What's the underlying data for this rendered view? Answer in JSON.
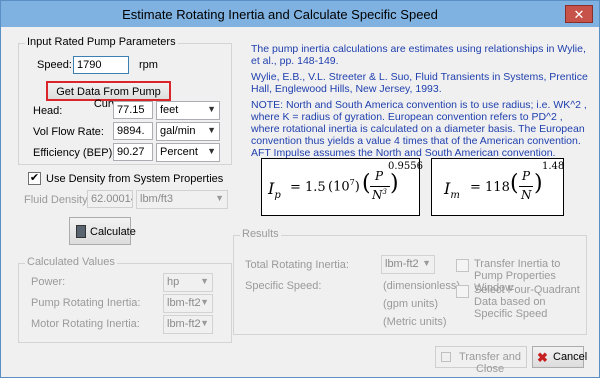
{
  "window": {
    "title": "Estimate Rotating Inertia and Calculate Specific Speed",
    "close_glyph": "✕"
  },
  "input_group": {
    "title": "Input Rated Pump Parameters",
    "speed_label": "Speed:",
    "speed_value": "1790",
    "speed_unit": "rpm",
    "get_data_button": "Get Data From Pump Curve",
    "head_label": "Head:",
    "head_value": "77.15",
    "head_unit": "feet",
    "flow_label": "Vol Flow Rate:",
    "flow_value": "9894.",
    "flow_unit": "gal/min",
    "eff_label": "Efficiency (BEP):",
    "eff_value": "90.27",
    "eff_unit": "Percent"
  },
  "density": {
    "checkbox_label": "Use Density from System Properties",
    "checked": "✔",
    "fluid_label": "Fluid Density:",
    "fluid_value": "62.00014",
    "fluid_unit": "lbm/ft3"
  },
  "calculate_button": "Calculate",
  "calculated": {
    "title": "Calculated Values",
    "power_label": "Power:",
    "power_unit": "hp",
    "pump_inertia_label": "Pump Rotating Inertia:",
    "pump_inertia_unit": "lbm-ft2",
    "motor_inertia_label": "Motor Rotating Inertia:",
    "motor_inertia_unit": "lbm-ft2"
  },
  "notes": {
    "p1": "The pump inertia calculations are estimates using relationships in Wylie, et al., pp. 148-149.",
    "p2": "Wylie, E.B., V.L. Streeter & L. Suo, Fluid Transients in Systems, Prentice Hall, Englewood Hills, New Jersey, 1993.",
    "p3": "NOTE:    North and South America convention is to use radius; i.e. WK^2 , where K = radius of gyration. European convention refers to PD^2 , where rotational inertia is calculated on a diameter basis. The European convention thus yields a value 4 times that of the American convention. AFT Impulse assumes the North and South American convention."
  },
  "equations": {
    "ip": {
      "lhs": "I",
      "sub": "p",
      "eq": "= 1.5",
      "coef": "10",
      "coef_exp": "7",
      "num": "P",
      "den": "N",
      "den_exp": "3",
      "exp": "0.9556"
    },
    "im": {
      "lhs": "I",
      "sub": "m",
      "eq": "= 118",
      "num": "P",
      "den": "N",
      "exp": "1.48"
    }
  },
  "results": {
    "title": "Results",
    "total_label": "Total Rotating Inertia:",
    "total_unit": "lbm-ft2",
    "specific_label": "Specific Speed:",
    "dimless": "(dimensionless)",
    "gpm": "(gpm units)",
    "metric": "(Metric units)",
    "transfer_check": "Transfer Inertia to Pump Properties Window",
    "four_quad_check": "Select Four-Quadrant Data based on Specific Speed"
  },
  "footer": {
    "transfer_button": "Transfer and Close",
    "cancel_button": "Cancel"
  },
  "colors": {
    "titlebar": "#7fb2e0",
    "note_text": "#1f3fae",
    "highlight": "#d9262b"
  }
}
